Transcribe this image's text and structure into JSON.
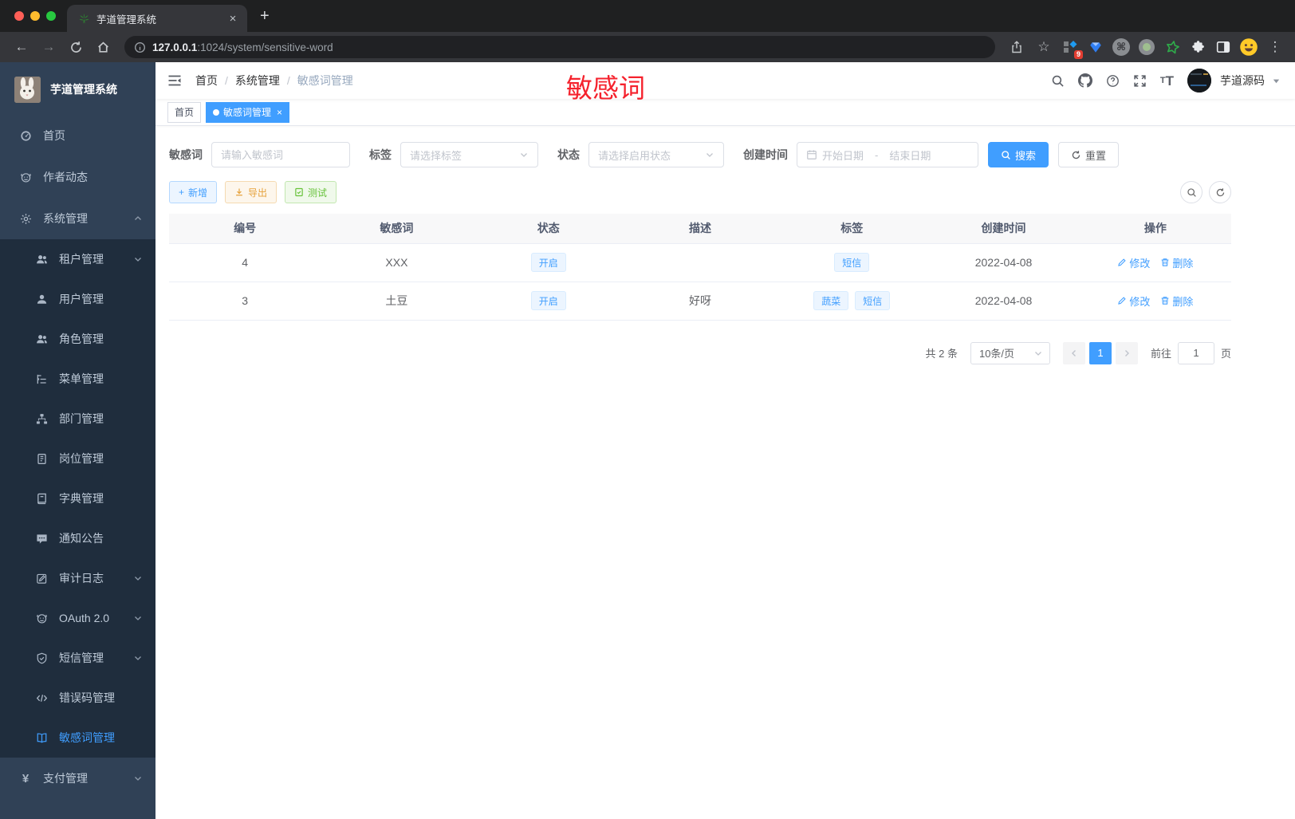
{
  "colors": {
    "accent": "#409eff",
    "annotation-red": "#f5222d",
    "success-green": "#67c23a",
    "warning-yellow": "#e6a23c",
    "sidebar-bg": "#304156",
    "sidebar-sub-bg": "#1f2d3d",
    "sidebar-text": "#bfcbd9"
  },
  "browser": {
    "tab_title": "芋道管理系统",
    "tab_close_glyph": "×",
    "new_tab_glyph": "+",
    "back_glyph": "←",
    "forward_glyph": "→",
    "url_host": "127.0.0.1",
    "url_rest": ":1024/system/sensitive-word",
    "star_glyph": "☆",
    "extension_badge": "9",
    "command_glyph": "⌘",
    "menu_dots_glyph": "⋮"
  },
  "sidebar": {
    "logo_title": "芋道管理系统",
    "items": [
      {
        "label": "首页"
      },
      {
        "label": "作者动态"
      },
      {
        "label": "系统管理"
      },
      {
        "label": "租户管理"
      },
      {
        "label": "用户管理"
      },
      {
        "label": "角色管理"
      },
      {
        "label": "菜单管理"
      },
      {
        "label": "部门管理"
      },
      {
        "label": "岗位管理"
      },
      {
        "label": "字典管理"
      },
      {
        "label": "通知公告"
      },
      {
        "label": "审计日志"
      },
      {
        "label": "OAuth 2.0"
      },
      {
        "label": "短信管理"
      },
      {
        "label": "错误码管理"
      },
      {
        "label": "敏感词管理"
      },
      {
        "label": "支付管理"
      }
    ]
  },
  "navbar": {
    "breadcrumb": [
      "首页",
      "系统管理",
      "敏感词管理"
    ],
    "breadcrumb_separator": "/",
    "annotation": "敏感词",
    "username": "芋道源码"
  },
  "tags": {
    "home": "首页",
    "current": "敏感词管理",
    "close_glyph": "×"
  },
  "filters": {
    "keyword_label": "敏感词",
    "keyword_placeholder": "请输入敏感词",
    "tag_label": "标签",
    "tag_placeholder": "请选择标签",
    "status_label": "状态",
    "status_placeholder": "请选择启用状态",
    "date_label": "创建时间",
    "date_start_placeholder": "开始日期",
    "date_separator": "-",
    "date_end_placeholder": "结束日期",
    "search_label": "搜索",
    "reset_label": "重置"
  },
  "toolbar": {
    "add_label": "新增",
    "add_glyph": "+",
    "export_label": "导出",
    "test_label": "测试"
  },
  "table": {
    "headers": [
      "编号",
      "敏感词",
      "状态",
      "描述",
      "标签",
      "创建时间",
      "操作"
    ],
    "edit_label": "修改",
    "delete_label": "删除",
    "rows": [
      {
        "id": "4",
        "word": "XXX",
        "status": "开启",
        "description": "",
        "tags": [
          "短信"
        ],
        "created": "2022-04-08"
      },
      {
        "id": "3",
        "word": "土豆",
        "status": "开启",
        "description": "好呀",
        "tags": [
          "蔬菜",
          "短信"
        ],
        "created": "2022-04-08"
      }
    ]
  },
  "pagination": {
    "total_text": "共 2 条",
    "page_size": "10条/页",
    "current_page": "1",
    "goto_label": "前往",
    "goto_value": "1",
    "page_suffix": "页"
  }
}
